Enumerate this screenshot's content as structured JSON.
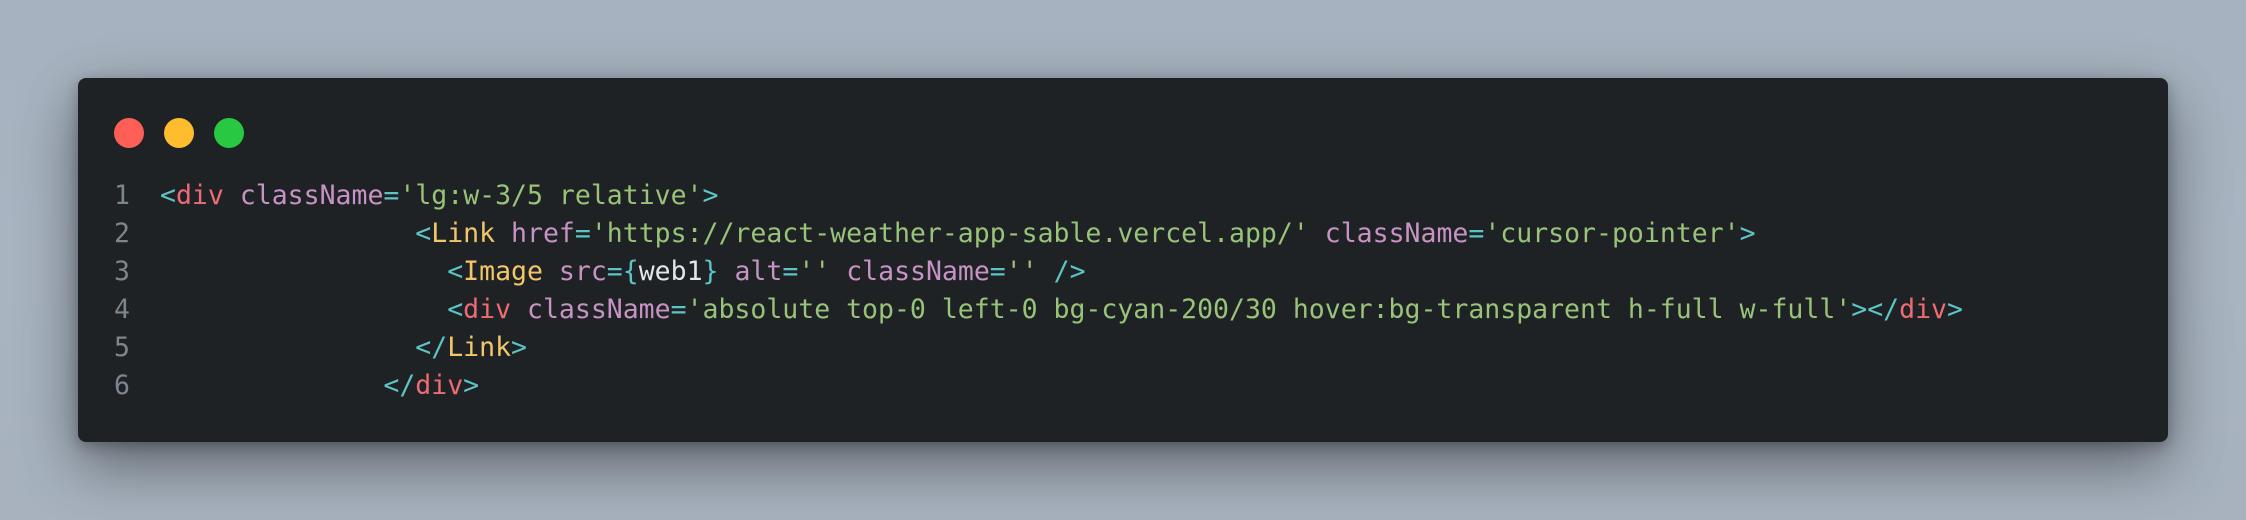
{
  "window": {
    "controls": [
      "close",
      "minimize",
      "maximize"
    ],
    "colors": {
      "background": "#1e2225",
      "close": "#ff5f57",
      "minimize": "#febc2e",
      "maximize": "#28c840"
    }
  },
  "code": {
    "lines": [
      {
        "number": "1",
        "indent": "",
        "tokens": [
          {
            "t": "<",
            "c": "punc"
          },
          {
            "t": "div",
            "c": "tag"
          },
          {
            "t": " ",
            "c": "ident"
          },
          {
            "t": "className",
            "c": "attr"
          },
          {
            "t": "=",
            "c": "punc"
          },
          {
            "t": "'lg:w-3/5 relative'",
            "c": "str"
          },
          {
            "t": ">",
            "c": "punc"
          }
        ]
      },
      {
        "number": "2",
        "indent": "                ",
        "tokens": [
          {
            "t": "<",
            "c": "punc"
          },
          {
            "t": "Link",
            "c": "comp"
          },
          {
            "t": " ",
            "c": "ident"
          },
          {
            "t": "href",
            "c": "attr"
          },
          {
            "t": "=",
            "c": "punc"
          },
          {
            "t": "'https://react-weather-app-sable.vercel.app/'",
            "c": "str"
          },
          {
            "t": " ",
            "c": "ident"
          },
          {
            "t": "className",
            "c": "attr"
          },
          {
            "t": "=",
            "c": "punc"
          },
          {
            "t": "'cursor-pointer'",
            "c": "str"
          },
          {
            "t": ">",
            "c": "punc"
          }
        ]
      },
      {
        "number": "3",
        "indent": "                  ",
        "tokens": [
          {
            "t": "<",
            "c": "punc"
          },
          {
            "t": "Image",
            "c": "comp"
          },
          {
            "t": " ",
            "c": "ident"
          },
          {
            "t": "src",
            "c": "attr"
          },
          {
            "t": "={",
            "c": "punc"
          },
          {
            "t": "web1",
            "c": "ident"
          },
          {
            "t": "}",
            "c": "punc"
          },
          {
            "t": " ",
            "c": "ident"
          },
          {
            "t": "alt",
            "c": "attr"
          },
          {
            "t": "=",
            "c": "punc"
          },
          {
            "t": "''",
            "c": "str"
          },
          {
            "t": " ",
            "c": "ident"
          },
          {
            "t": "className",
            "c": "attr"
          },
          {
            "t": "=",
            "c": "punc"
          },
          {
            "t": "''",
            "c": "str"
          },
          {
            "t": " ",
            "c": "ident"
          },
          {
            "t": "/>",
            "c": "punc"
          }
        ]
      },
      {
        "number": "4",
        "indent": "                  ",
        "tokens": [
          {
            "t": "<",
            "c": "punc"
          },
          {
            "t": "div",
            "c": "tag"
          },
          {
            "t": " ",
            "c": "ident"
          },
          {
            "t": "className",
            "c": "attr"
          },
          {
            "t": "=",
            "c": "punc"
          },
          {
            "t": "'absolute top-0 left-0 bg-cyan-200/30 hover:bg-transparent h-full w-full'",
            "c": "str"
          },
          {
            "t": "></",
            "c": "punc"
          },
          {
            "t": "div",
            "c": "tag"
          },
          {
            "t": ">",
            "c": "punc"
          }
        ]
      },
      {
        "number": "5",
        "indent": "                ",
        "tokens": [
          {
            "t": "</",
            "c": "punc"
          },
          {
            "t": "Link",
            "c": "comp"
          },
          {
            "t": ">",
            "c": "punc"
          }
        ]
      },
      {
        "number": "6",
        "indent": "              ",
        "tokens": [
          {
            "t": "</",
            "c": "punc"
          },
          {
            "t": "div",
            "c": "tag"
          },
          {
            "t": ">",
            "c": "punc"
          }
        ]
      }
    ]
  }
}
